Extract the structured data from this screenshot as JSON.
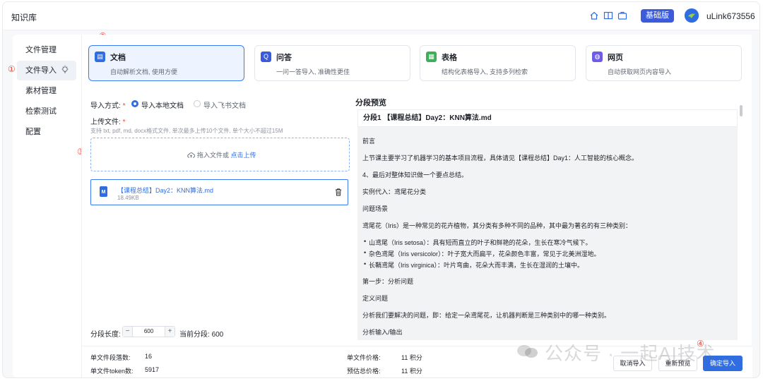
{
  "app": {
    "title": "知识库"
  },
  "topbar": {
    "plan_badge": "基础版",
    "username": "uLink673556"
  },
  "sidebar": {
    "items": [
      {
        "label": "文件管理"
      },
      {
        "label": "文件导入"
      },
      {
        "label": "素材管理"
      },
      {
        "label": "检索测试"
      },
      {
        "label": "配置"
      }
    ],
    "active_index": 1
  },
  "annotations": [
    "①",
    "②",
    "③",
    "④"
  ],
  "import_types": [
    {
      "title": "文档",
      "desc": "自动解析文档, 使用方便",
      "icon": "document-icon",
      "color": "#2f6de1"
    },
    {
      "title": "问答",
      "desc": "一问一答导入, 准确性更佳",
      "icon": "qa-icon",
      "color": "#3b5bdb"
    },
    {
      "title": "表格",
      "desc": "结构化表格导入, 支持多列检索",
      "icon": "table-icon",
      "color": "#3fae5a"
    },
    {
      "title": "网页",
      "desc": "自动获取网页内容导入",
      "icon": "web-icon",
      "color": "#6e5ce6"
    }
  ],
  "form": {
    "method_label": "导入方式:",
    "method_local": "导入本地文档",
    "method_feishu": "导入飞书文档",
    "upload_label": "上传文件:",
    "upload_hint": "支持 txt, pdf, md, docx格式文件, 单次最多上传10个文件, 单个大小不超过15M",
    "drop_text": "拖入文件或",
    "drop_link": "点击上传",
    "file": {
      "name": "【课程总结】Day2：KNN算法.md",
      "size": "18.49KB",
      "type": "M"
    },
    "seg_length_label": "分段长度:",
    "seg_length_value": "600",
    "current_seg_label": "当前分段:",
    "current_seg_value": "600"
  },
  "preview": {
    "title": "分段预览",
    "segment_header": "分段1 【课程总结】Day2：KNN算法.md",
    "lines": [
      {
        "kind": "p",
        "text": "前言"
      },
      {
        "kind": "p",
        "text": "上节课主要学习了机器学习的基本项目流程，具体请见【课程总结】Day1：人工智能的核心概念。"
      },
      {
        "kind": "p",
        "text": "4、最后对整体知识做一个要点总结。"
      },
      {
        "kind": "p",
        "text": "实例代入：鸢尾花分类"
      },
      {
        "kind": "p",
        "text": "问题场景"
      },
      {
        "kind": "p",
        "text": "鸢尾花（Iris）是一种常见的花卉植物，其分类有多种不同的品种，其中最为著名的有三种类别："
      },
      {
        "kind": "li",
        "text": "山鸢尾（Iris setosa）：具有短而直立的叶子和鲜艳的花朵，生长在寒冷气候下。"
      },
      {
        "kind": "li",
        "text": "杂色鸢尾（Iris versicolor）：叶子宽大而扁平，花朵颜色丰富，常见于北美洲湿地。"
      },
      {
        "kind": "li",
        "text": "长鞘鸢尾（Iris virginica）：叶片弯曲，花朵大而丰满，生长在湿润的土壤中。"
      },
      {
        "kind": "p",
        "text": "第一步：分析问题"
      },
      {
        "kind": "p",
        "text": "定义问题"
      },
      {
        "kind": "p",
        "text": "分析我们要解决的问题，即：给定一朵鸢尾花，让机器判断是三种类别中的哪一种类别。"
      },
      {
        "kind": "p",
        "text": "分析输入/输出"
      }
    ]
  },
  "footer": {
    "seg_count_label": "单文件段落数:",
    "seg_count_value": "16",
    "token_label": "单文件token数:",
    "token_value": "5917",
    "price_label": "单文件价格:",
    "price_value": "11 积分",
    "total_price_label": "预估总价格:",
    "total_price_value": "11 积分",
    "cancel_label": "取消导入",
    "repreview_label": "重新预览",
    "confirm_label": "确定导入"
  },
  "watermark": "公众号 · 一起AI技术"
}
